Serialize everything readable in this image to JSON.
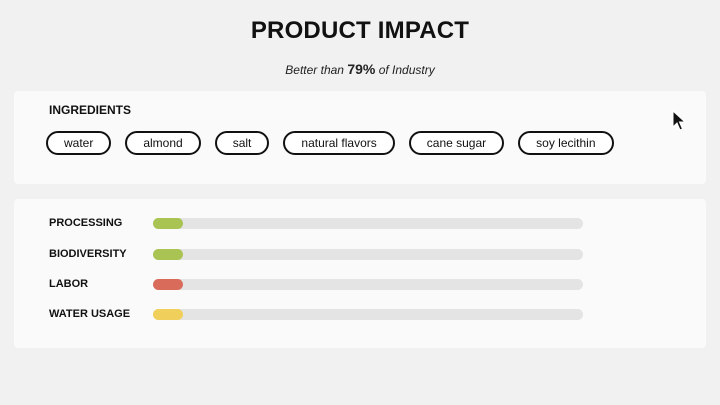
{
  "header": {
    "title": "PRODUCT IMPACT",
    "subtitle_prefix": "Better than",
    "subtitle_value": "79%",
    "subtitle_suffix": "of Industry"
  },
  "ingredients": {
    "heading": "INGREDIENTS",
    "items": [
      "water",
      "almond",
      "salt",
      "natural flavors",
      "cane sugar",
      "soy lecithin"
    ]
  },
  "impact": {
    "metrics": [
      {
        "label": "PROCESSING",
        "level": 0.07,
        "color": "#a9c452"
      },
      {
        "label": "BIODIVERSITY",
        "level": 0.07,
        "color": "#a9c452"
      },
      {
        "label": "LABOR",
        "level": 0.07,
        "color": "#d96b5a"
      },
      {
        "label": "WATER USAGE",
        "level": 0.07,
        "color": "#f0cf5a"
      }
    ]
  },
  "colors": {
    "background": "#f1f1f1",
    "card": "#fafafa",
    "track": "#e4e4e4"
  },
  "cursor": {
    "icon": "mouse-pointer-icon"
  }
}
